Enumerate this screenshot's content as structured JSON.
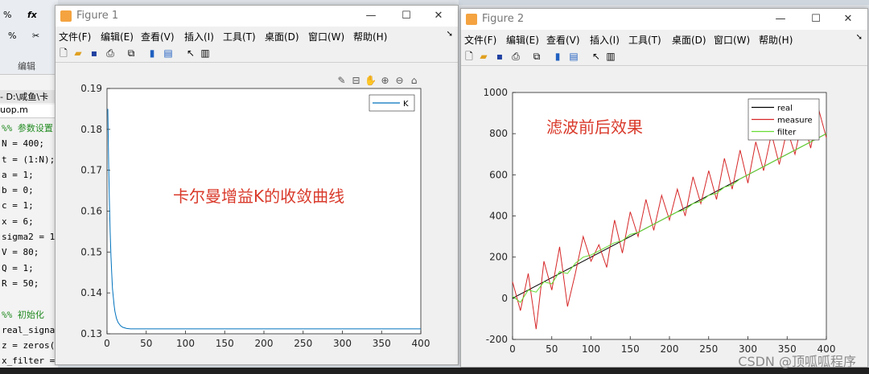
{
  "editor": {
    "ribbon_icons": [
      "%",
      "fx",
      "%",
      "✂"
    ],
    "ribbon_label": "编辑",
    "path": "- D:\\咸鱼\\卡",
    "file_tab": "uop.m",
    "code_lines": [
      {
        "text": "%% 参数设置",
        "comment": true
      },
      {
        "text": "N = 400;",
        "comment": false
      },
      {
        "text": "t = (1:N);",
        "comment": false
      },
      {
        "text": "a = 1;",
        "comment": false
      },
      {
        "text": "b = 0;",
        "comment": false
      },
      {
        "text": "c = 1;",
        "comment": false
      },
      {
        "text": "x = 6;",
        "comment": false
      },
      {
        "text": "sigma2 = 1",
        "comment": false
      },
      {
        "text": "V = 80;",
        "comment": false
      },
      {
        "text": "Q = 1;",
        "comment": false
      },
      {
        "text": "R = 50;",
        "comment": false
      },
      {
        "text": "",
        "comment": false
      },
      {
        "text": "%% 初始化",
        "comment": true
      },
      {
        "text": "real_signa",
        "comment": false
      },
      {
        "text": "z = zeros(",
        "comment": false
      },
      {
        "text": "x_filter =",
        "comment": false
      }
    ]
  },
  "figures": [
    {
      "id": "fig1",
      "title": "Figure 1",
      "window_buttons": {
        "minimize": "—",
        "maximize": "☐",
        "close": "✕"
      },
      "menus": [
        "文件(F)",
        "编辑(E)",
        "查看(V)",
        "插入(I)",
        "工具(T)",
        "桌面(D)",
        "窗口(W)",
        "帮助(H)"
      ],
      "menu_arrow": "➘",
      "toolbar_icons": [
        "new-icon",
        "open-icon",
        "save-icon",
        "print-icon",
        "link-icon",
        "colorbar-icon",
        "legend-icon",
        "pointer-icon",
        "property-icon"
      ],
      "axes_toolbar_icons": [
        "brush-icon",
        "data-tip-icon",
        "pan-icon",
        "zoom-in-icon",
        "zoom-out-icon",
        "home-icon"
      ]
    },
    {
      "id": "fig2",
      "title": "Figure 2",
      "window_buttons": {
        "minimize": "—",
        "maximize": "☐",
        "close": "✕"
      },
      "menus": [
        "文件(F)",
        "编辑(E)",
        "查看(V)",
        "插入(I)",
        "工具(T)",
        "桌面(D)",
        "窗口(W)",
        "帮助(H)"
      ],
      "menu_arrow": "➘",
      "toolbar_icons": [
        "new-icon",
        "open-icon",
        "save-icon",
        "print-icon",
        "link-icon",
        "colorbar-icon",
        "legend-icon",
        "pointer-icon",
        "property-icon"
      ]
    }
  ],
  "colors": {
    "annotation": "#d93a2b",
    "k_line": "#0072bd",
    "real": "#000000",
    "measure": "#d62728",
    "filter": "#66dd33"
  },
  "chart_data": [
    {
      "type": "line",
      "annotation": "卡尔曼增益K的收敛曲线",
      "xlim": [
        0,
        400
      ],
      "ylim": [
        0.13,
        0.19
      ],
      "xticks": [
        0,
        50,
        100,
        150,
        200,
        250,
        300,
        350,
        400
      ],
      "yticks": [
        0.13,
        0.14,
        0.15,
        0.16,
        0.17,
        0.18,
        0.19
      ],
      "legend_position": "top-right",
      "series": [
        {
          "name": "K",
          "x": [
            1,
            2,
            3,
            4,
            5,
            6,
            7,
            8,
            9,
            10,
            12,
            14,
            17,
            20,
            25,
            30,
            40,
            60,
            100,
            200,
            400
          ],
          "y": [
            0.185,
            0.172,
            0.163,
            0.155,
            0.149,
            0.145,
            0.141,
            0.139,
            0.137,
            0.1355,
            0.1338,
            0.1328,
            0.132,
            0.1316,
            0.1313,
            0.1312,
            0.1312,
            0.1312,
            0.1312,
            0.1312,
            0.1312
          ]
        }
      ]
    },
    {
      "type": "line",
      "annotation": "滤波前后效果",
      "xlim": [
        0,
        400
      ],
      "ylim": [
        -200,
        1000
      ],
      "xticks": [
        0,
        50,
        100,
        150,
        200,
        250,
        300,
        350,
        400
      ],
      "yticks": [
        -200,
        0,
        200,
        400,
        600,
        800,
        1000
      ],
      "legend_position": "top-right",
      "series": [
        {
          "name": "real",
          "x": [
            0,
            400
          ],
          "y": [
            0,
            800
          ]
        },
        {
          "name": "measure",
          "x": [
            0,
            10,
            20,
            30,
            40,
            50,
            60,
            70,
            80,
            90,
            100,
            110,
            120,
            130,
            140,
            150,
            160,
            170,
            180,
            190,
            200,
            210,
            220,
            230,
            240,
            250,
            260,
            270,
            280,
            290,
            300,
            310,
            320,
            330,
            340,
            350,
            360,
            370,
            380,
            390,
            400
          ],
          "y": [
            80,
            -60,
            120,
            -150,
            180,
            40,
            250,
            -40,
            120,
            300,
            180,
            260,
            150,
            380,
            220,
            420,
            300,
            480,
            330,
            500,
            380,
            530,
            400,
            590,
            460,
            620,
            480,
            680,
            530,
            720,
            560,
            760,
            620,
            800,
            650,
            820,
            700,
            880,
            730,
            920,
            780
          ]
        },
        {
          "name": "filter",
          "x": [
            0,
            10,
            20,
            30,
            40,
            50,
            60,
            70,
            80,
            90,
            100,
            110,
            120,
            130,
            140,
            150,
            160,
            170,
            180,
            190,
            200,
            210,
            220,
            230,
            240,
            250,
            260,
            270,
            280,
            290,
            300,
            310,
            320,
            330,
            340,
            350,
            360,
            370,
            380,
            390,
            400
          ],
          "y": [
            10,
            -20,
            40,
            30,
            80,
            70,
            130,
            120,
            170,
            200,
            210,
            230,
            250,
            270,
            280,
            310,
            320,
            340,
            360,
            380,
            400,
            420,
            430,
            460,
            470,
            500,
            510,
            540,
            550,
            580,
            600,
            620,
            640,
            660,
            680,
            700,
            720,
            740,
            760,
            780,
            800
          ]
        }
      ]
    }
  ],
  "watermark": "CSDN @顶呱呱程序"
}
